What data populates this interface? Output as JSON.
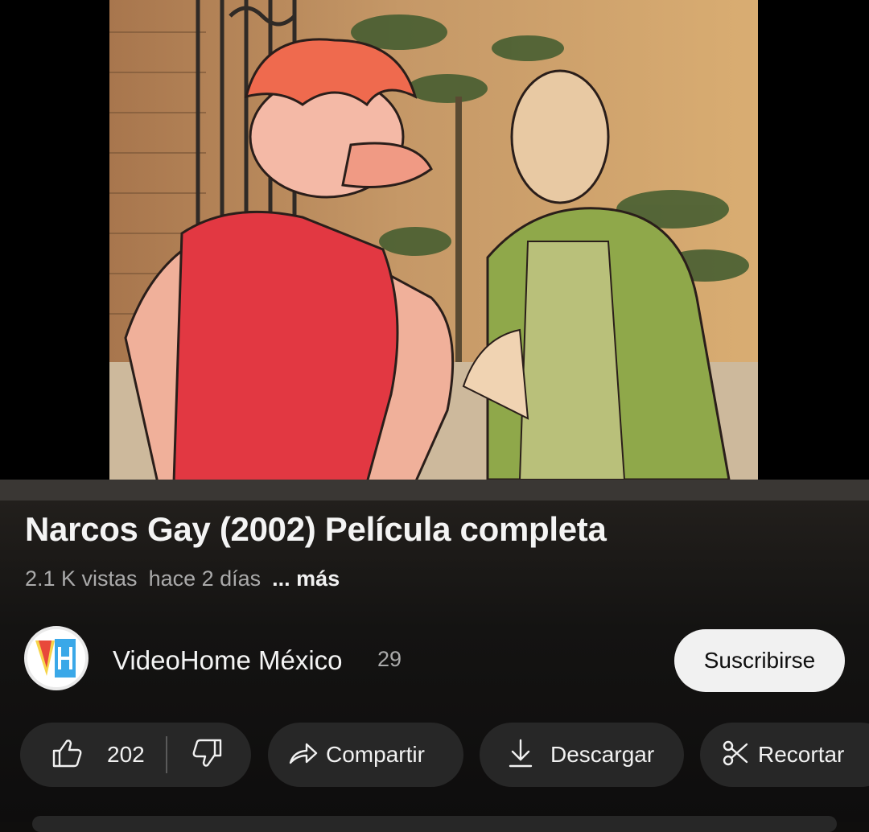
{
  "video": {
    "title": "Narcos Gay (2002) Película completa",
    "views": "2.1 K vistas",
    "age": "hace 2 días",
    "more_label": "... más"
  },
  "channel": {
    "name": "VideoHome México",
    "subscribers": "29",
    "subscribe_label": "Suscribirse",
    "avatar_icon": "videohome-logo"
  },
  "actions": {
    "like_count": "202",
    "like_icon": "thumbs-up-icon",
    "dislike_icon": "thumbs-down-icon",
    "share_label": "Compartir",
    "download_label": "Descargar",
    "clip_label": "Recortar"
  },
  "colors": {
    "background": "#0f0e0d",
    "pill": "#272727",
    "subscribe_bg": "#f1f1f1",
    "secondary_text": "#aaaaaa"
  }
}
